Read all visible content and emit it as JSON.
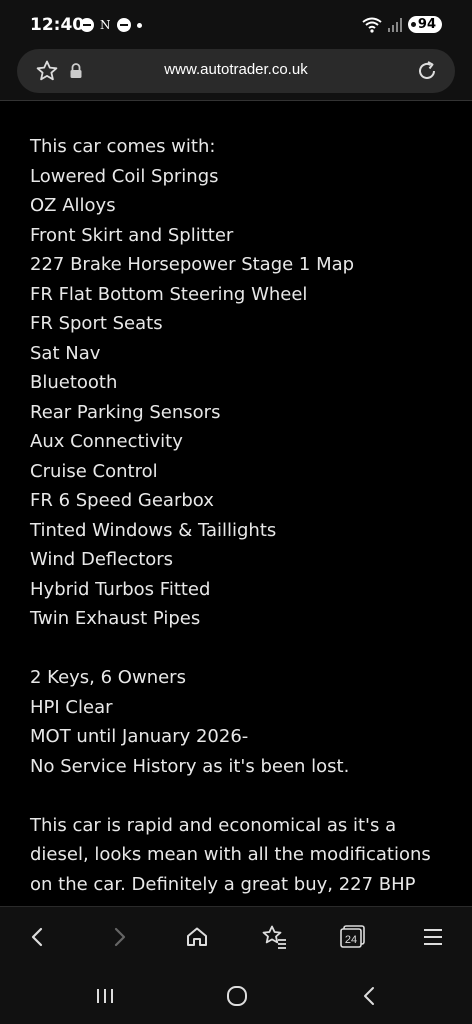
{
  "status_bar": {
    "time": "12:40",
    "battery": "94",
    "icons": [
      "dnd-icon",
      "n-icon",
      "dnd-icon",
      "dot-icon",
      "wifi-icon",
      "signal-icon",
      "battery-icon"
    ]
  },
  "browser": {
    "url": "www.autotrader.co.uk"
  },
  "listing": {
    "features_intro": "This car comes with:",
    "features": [
      "Lowered Coil Springs",
      "OZ Alloys",
      "Front Skirt and Splitter",
      "227 Brake Horsepower Stage 1 Map",
      "FR Flat Bottom Steering Wheel",
      "FR Sport Seats",
      "Sat Nav",
      "Bluetooth",
      "Rear Parking Sensors",
      "Aux Connectivity",
      "Cruise Control",
      "FR 6 Speed Gearbox",
      "Tinted Windows & Taillights",
      "Wind Deflectors",
      "Hybrid Turbos Fitted",
      "Twin Exhaust Pipes"
    ],
    "details": [
      "2 Keys, 6 Owners",
      "HPI Clear",
      "MOT until January 2026-",
      "No Service History as it's been lost."
    ],
    "description": "This car is rapid and economical as it's a diesel, looks mean with all the modifications on the car. Definitely a great buy, 227 BHP"
  },
  "toolbar": {
    "tabs_count": "24",
    "icons": [
      "back-icon",
      "forward-icon",
      "home-icon",
      "bookmarks-icon",
      "tabs-icon",
      "menu-icon"
    ]
  },
  "navbar": {
    "icons": [
      "recent-apps-icon",
      "home-button-icon",
      "back-nav-icon"
    ]
  }
}
